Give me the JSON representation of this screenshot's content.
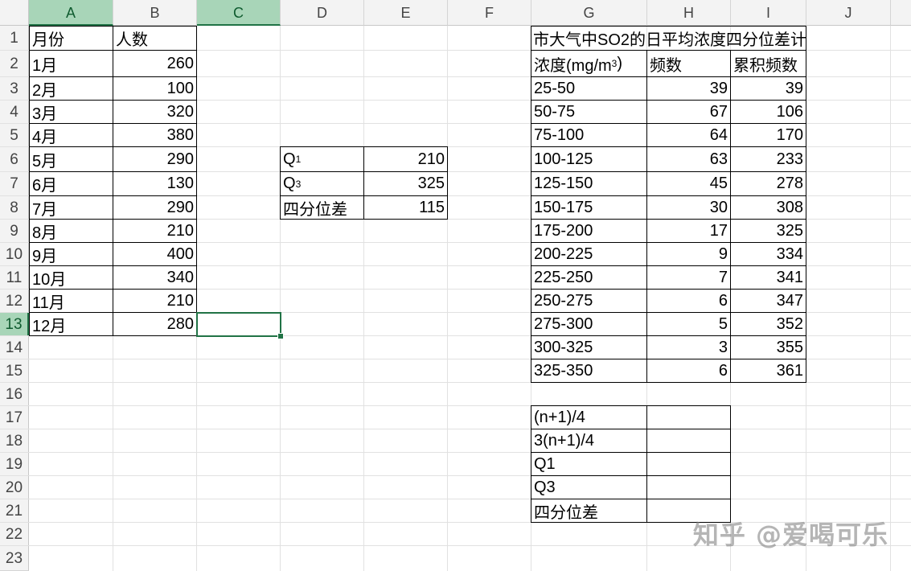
{
  "columns": [
    "A",
    "B",
    "C",
    "D",
    "E",
    "F",
    "G",
    "H",
    "I",
    "J"
  ],
  "selected_column": "C",
  "rows": [
    "1",
    "2",
    "3",
    "4",
    "5",
    "6",
    "7",
    "8",
    "9",
    "10",
    "11",
    "12",
    "13",
    "14",
    "15",
    "16",
    "17",
    "18",
    "19",
    "20",
    "21",
    "22",
    "23"
  ],
  "selected_row": "13",
  "monthly": {
    "header_month": "月份",
    "header_count": "人数",
    "rows": [
      {
        "month": "1月",
        "count": "260"
      },
      {
        "month": "2月",
        "count": "100"
      },
      {
        "month": "3月",
        "count": "320"
      },
      {
        "month": "4月",
        "count": "380"
      },
      {
        "month": "5月",
        "count": "290"
      },
      {
        "month": "6月",
        "count": "130"
      },
      {
        "month": "7月",
        "count": "290"
      },
      {
        "month": "8月",
        "count": "210"
      },
      {
        "month": "9月",
        "count": "400"
      },
      {
        "month": "10月",
        "count": "340"
      },
      {
        "month": "11月",
        "count": "210"
      },
      {
        "month": "12月",
        "count": "280"
      }
    ]
  },
  "quartiles": {
    "q1_label": "Q",
    "q1_sub": "1",
    "q1_value": "210",
    "q3_label": "Q",
    "q3_sub": "3",
    "q3_value": "325",
    "iqr_label": "四分位差",
    "iqr_value": "115"
  },
  "so2": {
    "title": "市大气中SO2的日平均浓度四分位差计",
    "header_conc": "浓度(mg/m",
    "header_conc_sup": "3",
    "header_conc_close": ")",
    "header_freq": "频数",
    "header_cum": "累积频数",
    "rows": [
      {
        "range": "25-50",
        "freq": "39",
        "cum": "39"
      },
      {
        "range": "50-75",
        "freq": "67",
        "cum": "106"
      },
      {
        "range": "75-100",
        "freq": "64",
        "cum": "170"
      },
      {
        "range": "100-125",
        "freq": "63",
        "cum": "233"
      },
      {
        "range": "125-150",
        "freq": "45",
        "cum": "278"
      },
      {
        "range": "150-175",
        "freq": "30",
        "cum": "308"
      },
      {
        "range": "175-200",
        "freq": "17",
        "cum": "325"
      },
      {
        "range": "200-225",
        "freq": "9",
        "cum": "334"
      },
      {
        "range": "225-250",
        "freq": "7",
        "cum": "341"
      },
      {
        "range": "250-275",
        "freq": "6",
        "cum": "347"
      },
      {
        "range": "275-300",
        "freq": "5",
        "cum": "352"
      },
      {
        "range": "300-325",
        "freq": "3",
        "cum": "355"
      },
      {
        "range": "325-350",
        "freq": "6",
        "cum": "361"
      }
    ]
  },
  "calc": {
    "rows": [
      {
        "label": "(n+1)/4",
        "value": ""
      },
      {
        "label": "3(n+1)/4",
        "value": ""
      },
      {
        "label": "Q1",
        "value": ""
      },
      {
        "label": "Q3",
        "value": ""
      },
      {
        "label": "四分位差",
        "value": ""
      }
    ]
  },
  "watermark": "知乎 @爱喝可乐",
  "colors": {
    "accent": "#217346",
    "header_selected": "#a8d5b8"
  }
}
